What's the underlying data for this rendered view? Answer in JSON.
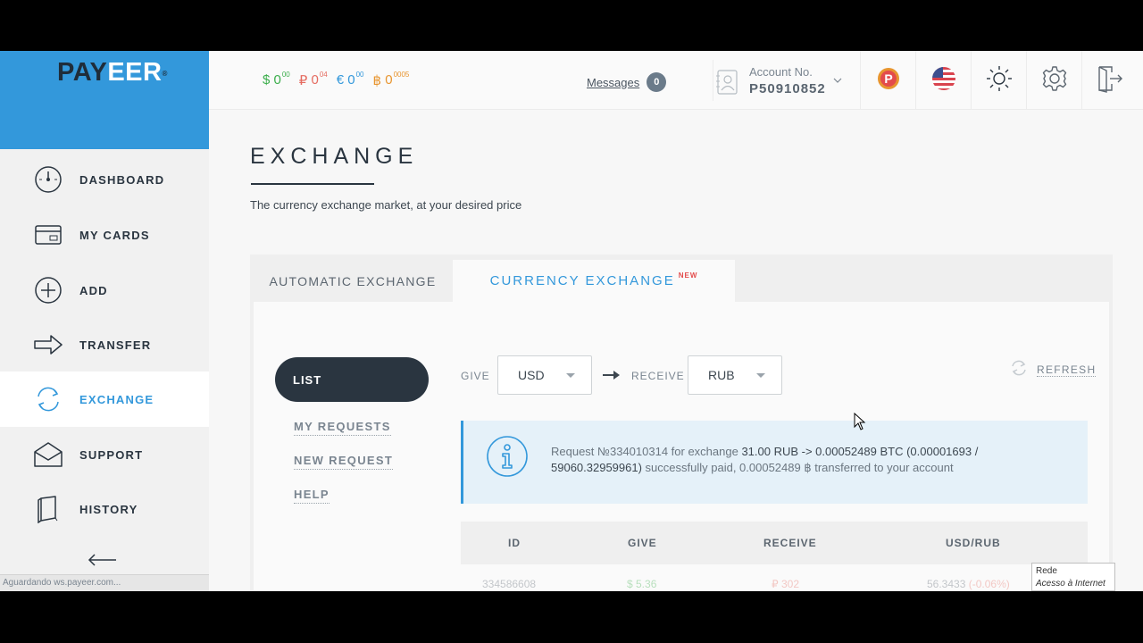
{
  "brand": {
    "logo_text_a": "PAY",
    "logo_text_b": "EER",
    "reg": "®",
    "accent": "#3398db"
  },
  "sidebar": {
    "items": [
      {
        "label": "DASHBOARD",
        "icon": "gauge-icon"
      },
      {
        "label": "MY CARDS",
        "icon": "card-icon"
      },
      {
        "label": "ADD",
        "icon": "plus-circle-icon"
      },
      {
        "label": "TRANSFER",
        "icon": "arrow-right-icon"
      },
      {
        "label": "EXCHANGE",
        "icon": "exchange-icon",
        "active": true
      },
      {
        "label": "SUPPORT",
        "icon": "envelope-icon"
      },
      {
        "label": "HISTORY",
        "icon": "book-icon"
      }
    ],
    "collapse_icon": "arrow-left-icon"
  },
  "header": {
    "balances": [
      {
        "symbol": "$",
        "int": "0",
        "dec": "00",
        "currency": "USD"
      },
      {
        "symbol": "₽",
        "int": "0",
        "dec": "04",
        "currency": "RUB"
      },
      {
        "symbol": "€",
        "int": "0",
        "dec": "00",
        "currency": "EUR"
      },
      {
        "symbol": "฿",
        "int": "0",
        "dec": "0005",
        "currency": "BTC"
      }
    ],
    "messages_label": "Messages",
    "messages_count": "0",
    "account_label": "Account No.",
    "account_number": "P50910852"
  },
  "page": {
    "title": "EXCHANGE",
    "subtitle": "The currency exchange market, at your desired price"
  },
  "tabs": {
    "automatic": "AUTOMATIC EXCHANGE",
    "currency": "CURRENCY EXCHANGE",
    "currency_badge": "NEW"
  },
  "menu": {
    "list": "LIST",
    "my_requests": "MY REQUESTS",
    "new_request": "NEW REQUEST",
    "help": "HELP"
  },
  "form": {
    "give_label": "GIVE",
    "give_value": "USD",
    "receive_label": "RECEIVE",
    "receive_value": "RUB",
    "refresh": "REFRESH"
  },
  "alert": {
    "p1": "Request №334010314 for exchange ",
    "p2": "31.00 RUB -> 0.00052489 BTC (0.00001693 / 59060.32959961)",
    "p3": " successfully paid, 0.00052489 ฿ transferred to your account"
  },
  "table": {
    "headers": [
      "ID",
      "GIVE",
      "RECEIVE",
      "USD/RUB"
    ],
    "rows": [
      {
        "id": "334586608",
        "give": "$ 5.36",
        "receive": "₽ 302",
        "rate": "56.3433",
        "change": "(-0.06%)"
      }
    ]
  },
  "statusbar": {
    "text": "Aguardando ws.payeer.com..."
  },
  "tooltip": {
    "line1": "Rede",
    "line2": "Acesso à Internet"
  }
}
